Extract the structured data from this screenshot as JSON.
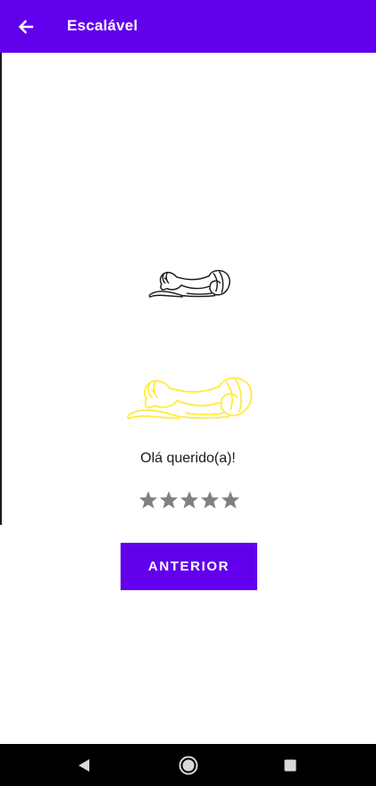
{
  "app_bar": {
    "title": "Escalável",
    "background_color": "#6200ee",
    "back_icon": "arrow-left-icon"
  },
  "content": {
    "image_small": {
      "icon": "lion-icon",
      "stroke_color": "#1a1a1a"
    },
    "image_large": {
      "icon": "lion-icon",
      "stroke_color": "#ffeb3b"
    },
    "greeting": "Olá querido(a)!",
    "rating": {
      "stars": 5,
      "filled": 5,
      "max": 5,
      "color": "#808080"
    },
    "previous_button_label": "ANTERIOR",
    "button_color": "#6200ee"
  },
  "system_nav": {
    "back_icon": "triangle-back-icon",
    "home_icon": "circle-home-icon",
    "recents_icon": "square-recents-icon"
  }
}
